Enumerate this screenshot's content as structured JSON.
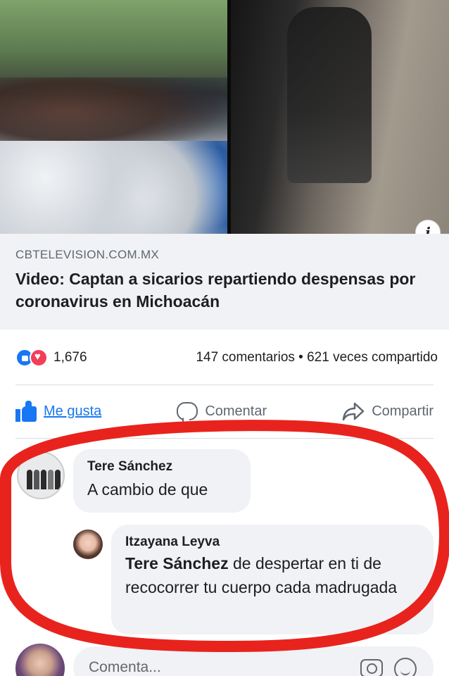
{
  "post": {
    "link_domain": "CBTELEVISION.COM.MX",
    "link_title": "Video: Captan a sicarios repartiendo despensas por coronavirus en Michoacán",
    "reaction_count": "1,676",
    "comments_shares": "147 comentarios • 621 veces compartido"
  },
  "actions": {
    "like": "Me gusta",
    "comment": "Comentar",
    "share": "Compartir"
  },
  "comments": [
    {
      "author": "Tere Sánchez",
      "text": "A cambio de que"
    },
    {
      "author": "Itzayana Leyva",
      "mention": "Tere Sánchez",
      "text": "de despertar en ti de recocorrer tu cuerpo cada madrugada"
    }
  ],
  "composer": {
    "placeholder": "Comenta..."
  },
  "colors": {
    "accent": "#1877f2",
    "highlight": "#e8231d"
  }
}
